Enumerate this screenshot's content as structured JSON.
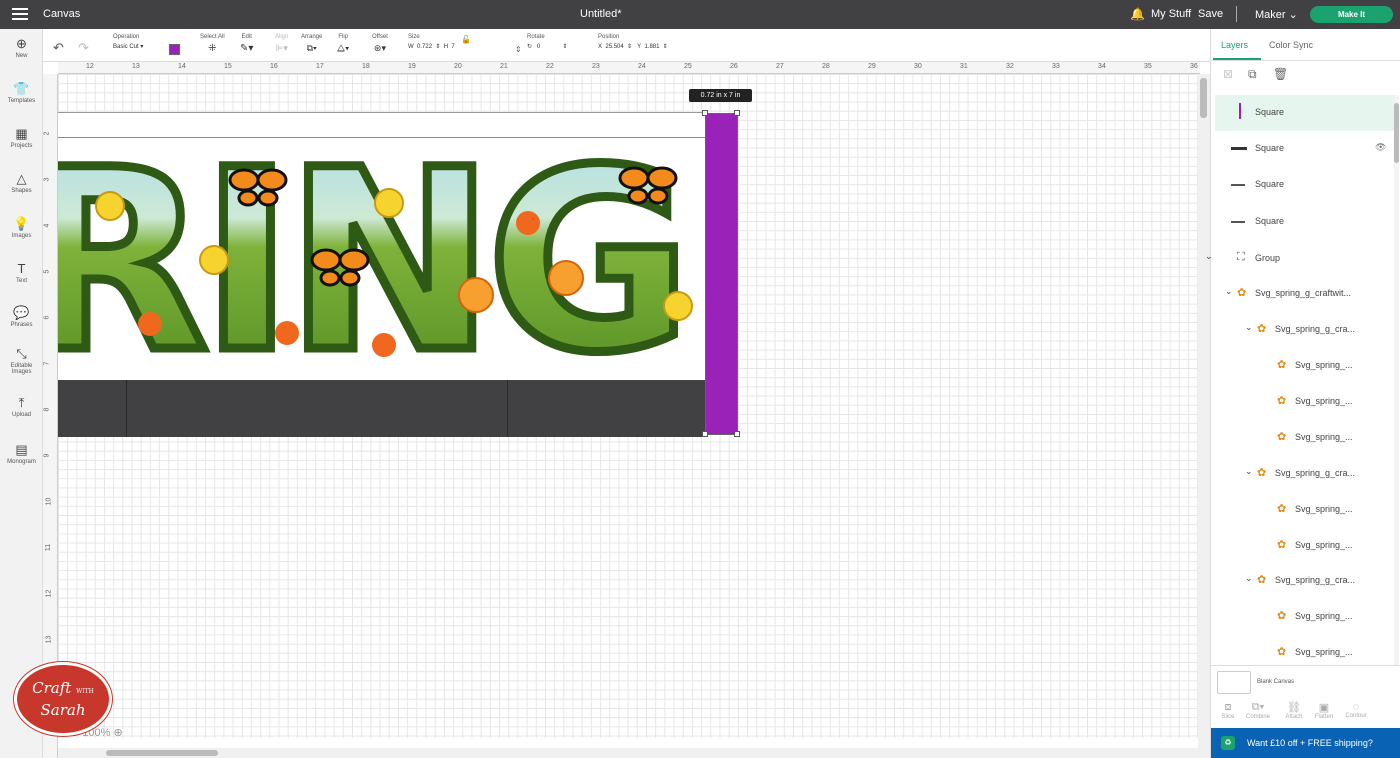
{
  "app": {
    "title": "Canvas",
    "document": "Untitled*",
    "my_stuff": "My Stuff",
    "save": "Save",
    "machine": "Maker",
    "make_it": "Make It"
  },
  "leftnav": [
    "New",
    "Templates",
    "Projects",
    "Shapes",
    "Images",
    "Text",
    "Phrases",
    "Editable Images",
    "Upload",
    "Monogram"
  ],
  "toolbar": {
    "operation_label": "Operation",
    "operation_value": "Basic Cut",
    "operation_color": "#9b22b8",
    "select_all": "Select All",
    "edit": "Edit",
    "align": "Align",
    "arrange": "Arrange",
    "flip": "Flip",
    "offset": "Offset",
    "size_label": "Size",
    "w_label": "W",
    "w_value": "0.722",
    "h_label": "H",
    "h_value": "7",
    "rotate_label": "Rotate",
    "rotate_value": "0",
    "position_label": "Position",
    "x_label": "X",
    "x_value": "25.504",
    "y_label": "Y",
    "y_value": "1.881"
  },
  "ruler": {
    "top": [
      "12",
      "13",
      "14",
      "15",
      "16",
      "17",
      "18",
      "19",
      "20",
      "21",
      "22",
      "23",
      "24",
      "25",
      "26",
      "27",
      "28",
      "29",
      "30",
      "31",
      "32",
      "33",
      "34",
      "35",
      "36"
    ],
    "left": [
      "2",
      "3",
      "4",
      "5",
      "6",
      "7",
      "8",
      "9",
      "10",
      "11",
      "12",
      "13"
    ]
  },
  "canvas": {
    "dimension_tip": "0.72 in x 7 in",
    "zoom": "100%",
    "art_text": "RING"
  },
  "panel": {
    "tabs": [
      "Layers",
      "Color Sync"
    ],
    "layers": [
      {
        "name": "Square",
        "icon": "thin-line",
        "color": "#9b22b8",
        "selected": true
      },
      {
        "name": "Square",
        "icon": "thick-line",
        "color": "#333"
      },
      {
        "name": "Square",
        "icon": "line",
        "color": "#555"
      },
      {
        "name": "Square",
        "icon": "line",
        "color": "#555"
      },
      {
        "name": "Group",
        "icon": "group"
      },
      {
        "name": "Svg_spring_g_craftwit..."
      },
      {
        "name": "Svg_spring_g_cra..."
      },
      {
        "name": "Svg_spring_..."
      },
      {
        "name": "Svg_spring_..."
      },
      {
        "name": "Svg_spring_..."
      },
      {
        "name": "Svg_spring_g_cra..."
      },
      {
        "name": "Svg_spring_..."
      },
      {
        "name": "Svg_spring_..."
      },
      {
        "name": "Svg_spring_g_cra..."
      },
      {
        "name": "Svg_spring_..."
      },
      {
        "name": "Svg_spring_..."
      }
    ],
    "blank_canvas": "Blank Canvas",
    "actions": [
      "Slice",
      "Combine",
      "Attach",
      "Flatten",
      "Contour"
    ],
    "promo": "Want £10 off + FREE shipping?"
  },
  "watermark": {
    "line1": "Craft",
    "with": "WITH",
    "line2": "Sarah"
  }
}
